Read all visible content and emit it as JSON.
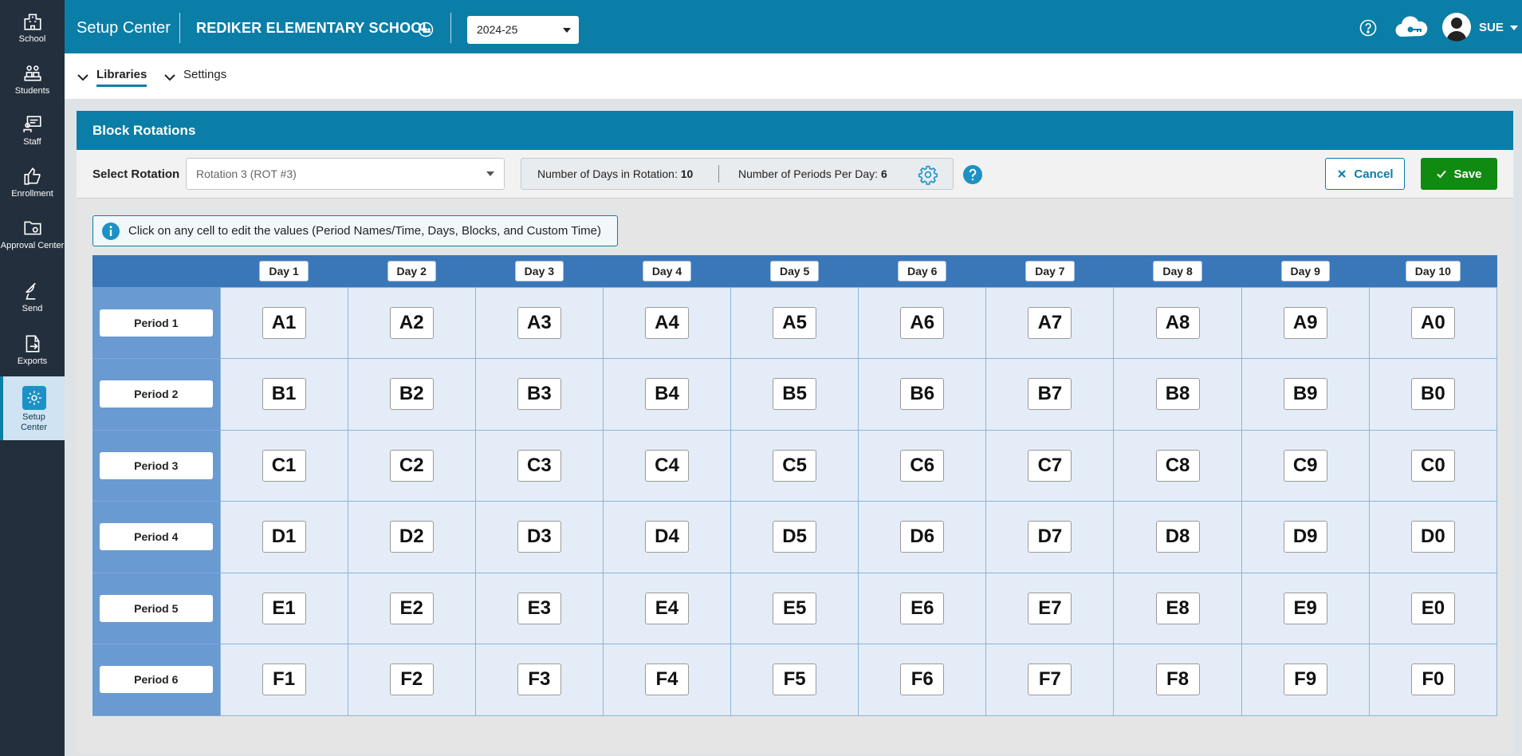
{
  "sidebar": {
    "items": [
      {
        "label": "School",
        "icon": "school-icon"
      },
      {
        "label": "Students",
        "icon": "students-icon"
      },
      {
        "label": "Staff",
        "icon": "staff-icon"
      },
      {
        "label": "Enrollment",
        "icon": "thumbs-up-icon"
      },
      {
        "label": "Approval Center",
        "icon": "folder-gear-icon"
      },
      {
        "label": "Send",
        "icon": "satellite-dish-icon"
      },
      {
        "label": "Exports",
        "icon": "export-icon"
      },
      {
        "label": "Setup Center",
        "icon": "gear-icon",
        "active": true
      }
    ]
  },
  "header": {
    "app_title": "Setup Center",
    "school_name": "REDIKER ELEMENTARY SCHOOL",
    "school_year": "2024-25",
    "user_name": "SUE"
  },
  "subnav": {
    "libraries": "Libraries",
    "settings": "Settings"
  },
  "panel": {
    "title": "Block Rotations",
    "select_label": "Select Rotation",
    "rotation_value": "Rotation 3 (ROT #3)",
    "days_label": "Number of Days in Rotation:",
    "days_value": "10",
    "periods_label": "Number of Periods Per Day:",
    "periods_value": "6",
    "cancel_label": "Cancel",
    "save_label": "Save",
    "hint": "Click on any cell to edit the values (Period Names/Time, Days, Blocks, and Custom Time)"
  },
  "grid": {
    "days": [
      "Day 1",
      "Day 2",
      "Day 3",
      "Day 4",
      "Day 5",
      "Day 6",
      "Day 7",
      "Day 8",
      "Day 9",
      "Day 10"
    ],
    "periods": [
      "Period 1",
      "Period 2",
      "Period 3",
      "Period 4",
      "Period 5",
      "Period 6"
    ],
    "blocks": [
      [
        "A1",
        "A2",
        "A3",
        "A4",
        "A5",
        "A6",
        "A7",
        "A8",
        "A9",
        "A0"
      ],
      [
        "B1",
        "B2",
        "B3",
        "B4",
        "B5",
        "B6",
        "B7",
        "B8",
        "B9",
        "B0"
      ],
      [
        "C1",
        "C2",
        "C3",
        "C4",
        "C5",
        "C6",
        "C7",
        "C8",
        "C9",
        "C0"
      ],
      [
        "D1",
        "D2",
        "D3",
        "D4",
        "D5",
        "D6",
        "D7",
        "D8",
        "D9",
        "D0"
      ],
      [
        "E1",
        "E2",
        "E3",
        "E4",
        "E5",
        "E6",
        "E7",
        "E8",
        "E9",
        "E0"
      ],
      [
        "F1",
        "F2",
        "F3",
        "F4",
        "F5",
        "F6",
        "F7",
        "F8",
        "F9",
        "F0"
      ]
    ]
  },
  "colors": {
    "topbar": "#0a7ea6",
    "sidebar": "#232f3d",
    "save": "#108a10",
    "grid_header": "#3a77b8",
    "period_column": "#6a9ad2",
    "cell": "#e4edf7"
  }
}
